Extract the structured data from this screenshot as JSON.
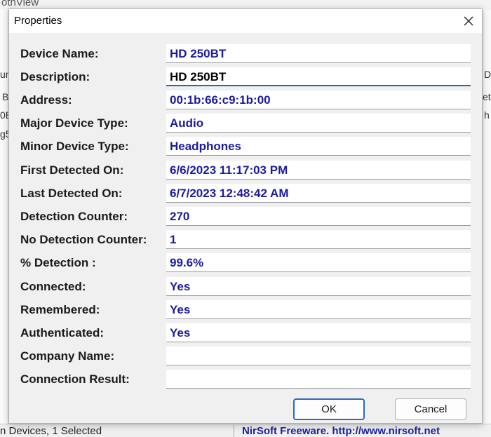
{
  "background": {
    "title_fragment": "othView",
    "left_fragments": [
      "um",
      "B",
      "0B",
      "g5"
    ],
    "right_fragments": [
      "D",
      "et",
      "h"
    ],
    "status_left": "n Devices, 1 Selected",
    "status_right": "NirSoft Freeware.  http://www.nirsoft.net"
  },
  "dialog": {
    "title": "Properties",
    "close_label": "✕",
    "fields": [
      {
        "label": "Device Name:",
        "value": "HD 250BT"
      },
      {
        "label": "Description:",
        "value": "HD 250BT"
      },
      {
        "label": "Address:",
        "value": "00:1b:66:c9:1b:00"
      },
      {
        "label": "Major Device Type:",
        "value": "Audio"
      },
      {
        "label": "Minor Device Type:",
        "value": "Headphones"
      },
      {
        "label": "First Detected On:",
        "value": "6/6/2023 11:17:03 PM"
      },
      {
        "label": "Last Detected On:",
        "value": "6/7/2023 12:48:42 AM"
      },
      {
        "label": "Detection Counter:",
        "value": "270"
      },
      {
        "label": "No Detection Counter:",
        "value": "1"
      },
      {
        "label": "% Detection :",
        "value": "99.6%"
      },
      {
        "label": "Connected:",
        "value": "Yes"
      },
      {
        "label": "Remembered:",
        "value": "Yes"
      },
      {
        "label": "Authenticated:",
        "value": "Yes"
      },
      {
        "label": "Company Name:",
        "value": ""
      },
      {
        "label": "Connection Result:",
        "value": ""
      }
    ],
    "ok_label": "OK",
    "cancel_label": "Cancel"
  }
}
